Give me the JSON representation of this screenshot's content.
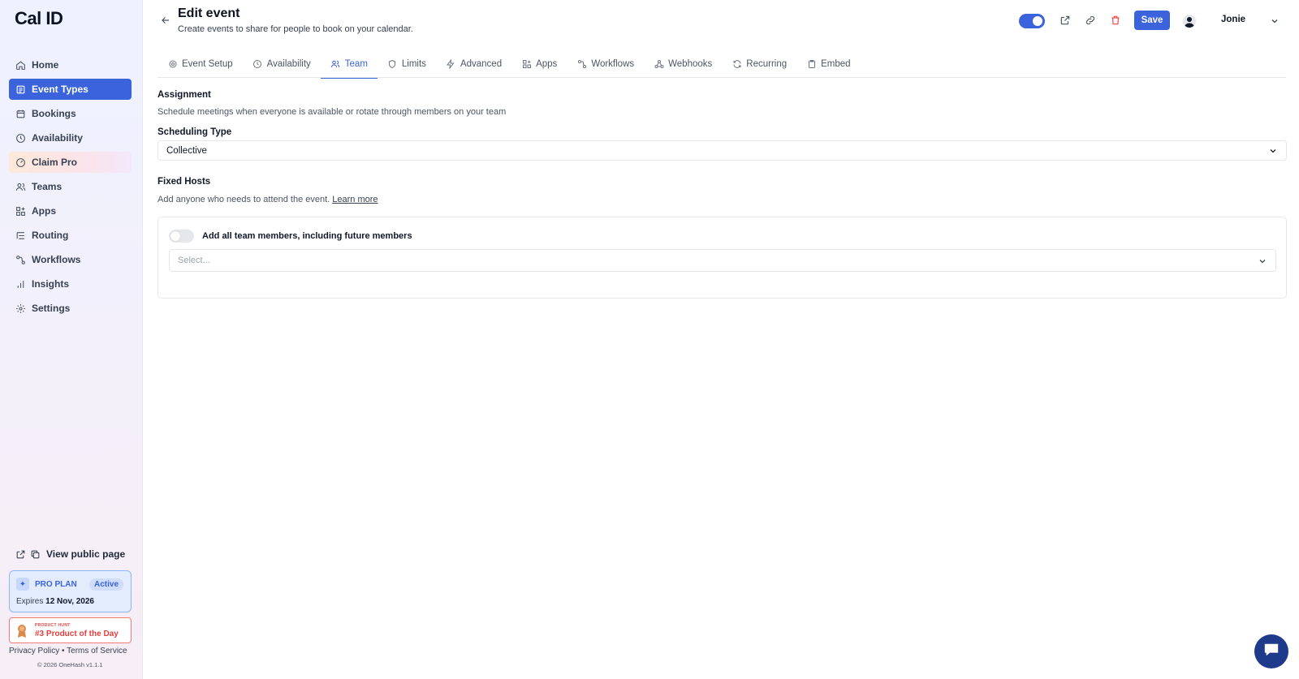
{
  "app": {
    "logo": "Cal ID"
  },
  "sidebar": {
    "items": [
      {
        "label": "Home",
        "icon": "home-icon"
      },
      {
        "label": "Event Types",
        "icon": "event-types-icon",
        "active": true
      },
      {
        "label": "Bookings",
        "icon": "calendar-icon"
      },
      {
        "label": "Availability",
        "icon": "clock-icon"
      },
      {
        "label": "Claim Pro",
        "icon": "gauge-icon"
      },
      {
        "label": "Teams",
        "icon": "users-icon"
      },
      {
        "label": "Apps",
        "icon": "grid-plus-icon"
      },
      {
        "label": "Routing",
        "icon": "routing-icon"
      },
      {
        "label": "Workflows",
        "icon": "workflow-icon"
      },
      {
        "label": "Insights",
        "icon": "bar-chart-icon"
      },
      {
        "label": "Settings",
        "icon": "gear-icon"
      }
    ],
    "view_public": "View public page",
    "plan": {
      "name": "PRO PLAN",
      "badge": "Active",
      "expires_label": "Expires",
      "expires_date": "12 Nov, 2026"
    },
    "producthunt": {
      "small": "PRODUCT HUNT",
      "big": "#3 Product of the Day"
    },
    "footer": {
      "privacy": "Privacy Policy",
      "separator": "•",
      "terms": "Terms of Service",
      "copyright": "© 2026 OneHash v1.1.1"
    }
  },
  "header": {
    "title": "Edit event",
    "subtitle": "Create events to share for people to book on your calendar.",
    "save_label": "Save",
    "user_name": "Jonie",
    "toggle_enabled": true
  },
  "tabs": [
    {
      "label": "Event Setup",
      "icon": "gear-icon"
    },
    {
      "label": "Availability",
      "icon": "clock-icon"
    },
    {
      "label": "Team",
      "icon": "users-icon",
      "active": true
    },
    {
      "label": "Limits",
      "icon": "shield-icon"
    },
    {
      "label": "Advanced",
      "icon": "bolt-icon"
    },
    {
      "label": "Apps",
      "icon": "grid-plus-icon"
    },
    {
      "label": "Workflows",
      "icon": "workflow-icon"
    },
    {
      "label": "Webhooks",
      "icon": "webhook-icon"
    },
    {
      "label": "Recurring",
      "icon": "refresh-icon"
    },
    {
      "label": "Embed",
      "icon": "clipboard-icon"
    }
  ],
  "assignment": {
    "heading": "Assignment",
    "description": "Schedule meetings when everyone is available or rotate through members on your team",
    "scheduling_type_label": "Scheduling Type",
    "scheduling_type_value": "Collective"
  },
  "fixed_hosts": {
    "heading": "Fixed Hosts",
    "description": "Add anyone who needs to attend the event.",
    "learn_more": "Learn more",
    "toggle_label": "Add all team members, including future members",
    "select_placeholder": "Select..."
  },
  "colors": {
    "accent": "#3b63db",
    "danger": "#ef4444",
    "chat": "#1e3a8a"
  }
}
